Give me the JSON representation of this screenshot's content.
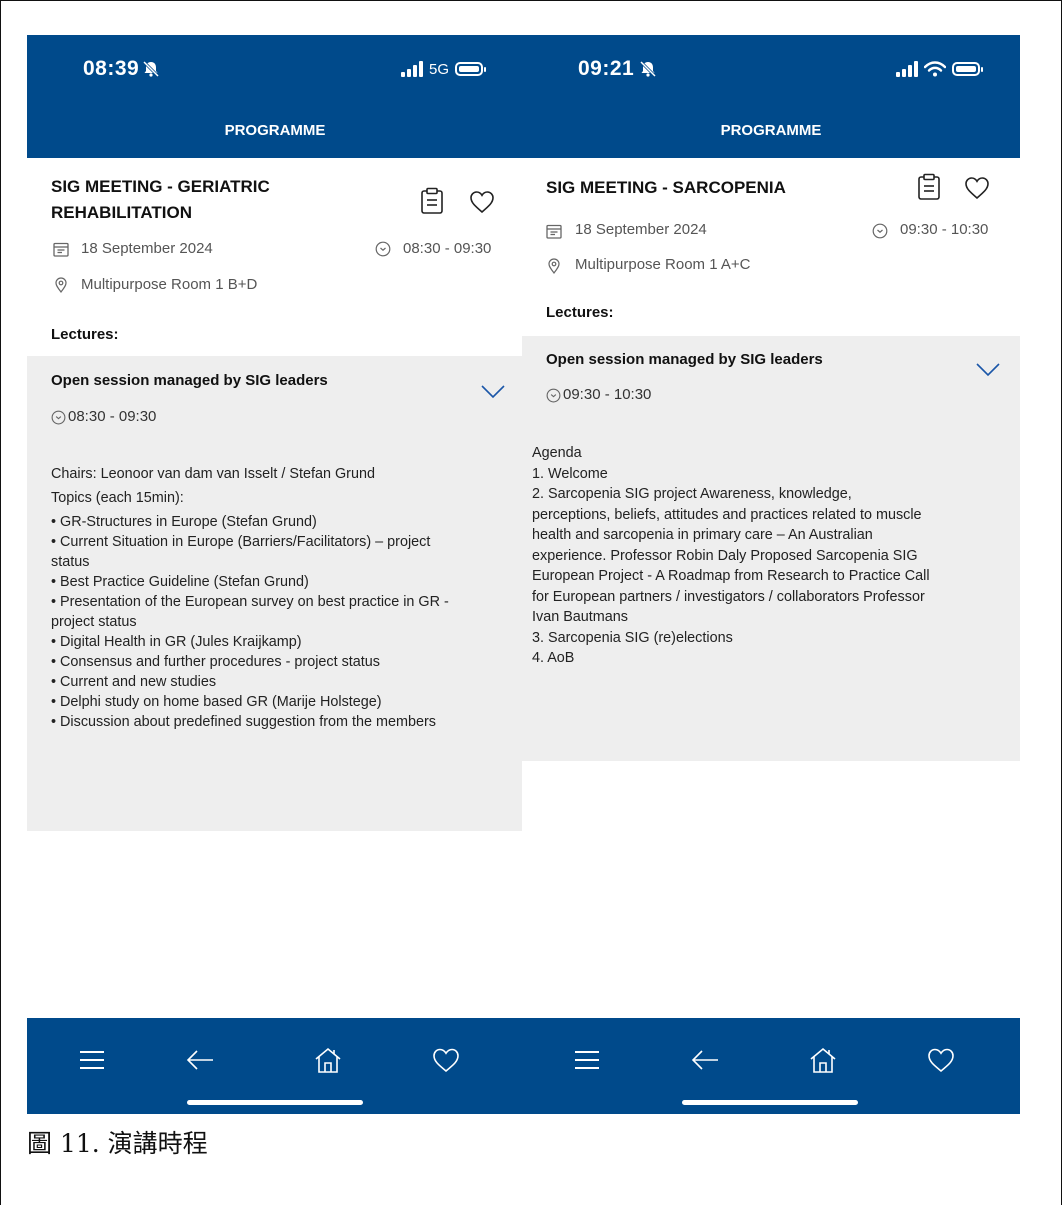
{
  "caption": "圖 11. 演講時程",
  "screens": [
    {
      "status": {
        "time": "08:39",
        "network": "5G"
      },
      "header": {
        "title": "PROGRAMME"
      },
      "session": {
        "title_line1": "SIG MEETING - GERIATRIC",
        "title_line2": "REHABILITATION",
        "date": "18 September 2024",
        "time": "08:30 - 09:30",
        "location": "Multipurpose Room 1 B+D",
        "lectures_label": "Lectures:"
      },
      "lecture": {
        "title": "Open session managed by SIG leaders",
        "time": "08:30 - 09:30",
        "lines": [
          "Chairs: Leonoor van dam van Isselt / Stefan Grund",
          "Topics (each 15min):",
          "• GR-Structures in Europe (Stefan Grund)",
          "• Current Situation in Europe (Barriers/Facilitators) – project",
          "status",
          "• Best Practice Guideline (Stefan Grund)",
          "• Presentation of the European survey on best practice in GR -",
          "project status",
          "• Digital Health in GR (Jules Kraijkamp)",
          "• Consensus and further procedures - project status",
          "• Current and new studies",
          "• Delphi study on home based GR (Marije Holstege)",
          "• Discussion about predefined suggestion from the members"
        ]
      }
    },
    {
      "status": {
        "time": "09:21"
      },
      "header": {
        "title": "PROGRAMME"
      },
      "session": {
        "title_line1": "SIG MEETING - SARCOPENIA",
        "date": "18 September 2024",
        "time": "09:30 - 10:30",
        "location": "Multipurpose Room 1 A+C",
        "lectures_label": "Lectures:"
      },
      "lecture": {
        "title": "Open session managed by SIG leaders",
        "time": "09:30 - 10:30",
        "lines": [
          "Agenda",
          "1. Welcome",
          "2. Sarcopenia SIG project Awareness, knowledge,",
          "perceptions, beliefs, attitudes and practices related to muscle",
          "health and sarcopenia in primary care – An Australian",
          "experience. Professor Robin Daly Proposed Sarcopenia SIG",
          "European Project - A Roadmap from Research to Practice Call",
          "for European partners / investigators / collaborators Professor",
          "Ivan Bautmans",
          "3. Sarcopenia SIG (re)elections",
          "4. AoB"
        ]
      }
    }
  ],
  "colors": {
    "brand": "#004a8b",
    "panel": "#eeeeee",
    "meta": "#555555"
  },
  "icons": [
    "bell-off-icon",
    "signal-icon",
    "wifi-icon",
    "battery-icon",
    "clipboard-icon",
    "heart-icon",
    "calendar-icon",
    "clock-icon",
    "location-pin-icon",
    "chevron-down-icon",
    "menu-icon",
    "back-arrow-icon",
    "home-icon",
    "favorites-heart-icon"
  ]
}
